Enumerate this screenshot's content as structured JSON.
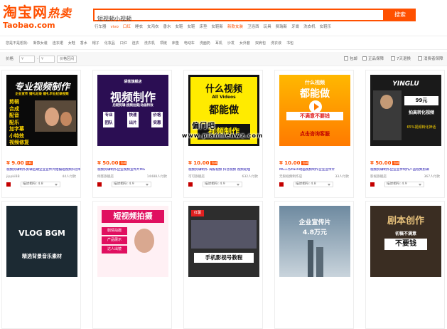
{
  "header": {
    "logo_cn": "淘宝网",
    "logo_sub": "热卖",
    "logo_en": "Taobao.com",
    "search_value": "短视频小视频",
    "search_button": "搜索",
    "hot_words": [
      {
        "label": "行车器",
        "hl": false
      },
      {
        "label": "vivo",
        "hl": true
      },
      {
        "label": "口红",
        "hl": true
      },
      {
        "label": "睡衣",
        "hl": false
      },
      {
        "label": "女鸿衣",
        "hl": false
      },
      {
        "label": "香水",
        "hl": false
      },
      {
        "label": "女鞋",
        "hl": false
      },
      {
        "label": "女鞋",
        "hl": false
      },
      {
        "label": "床垫",
        "hl": false
      },
      {
        "label": "女鞋新",
        "hl": false
      },
      {
        "label": "新款女装",
        "hl": true
      },
      {
        "label": "卫浴西",
        "hl": false
      },
      {
        "label": "玩具",
        "hl": false
      },
      {
        "label": "费瑞新",
        "hl": false
      },
      {
        "label": "牙膏",
        "hl": false
      },
      {
        "label": "洗衣机",
        "hl": false
      },
      {
        "label": "女鞋乐",
        "hl": false
      }
    ]
  },
  "nav": {
    "label": "您是不是想找:",
    "items": [
      "新款女装",
      "连衣裙",
      "女鞋",
      "香水",
      "帽子",
      "化妆品",
      "口红",
      "连衣",
      "洗衣机",
      "项链",
      "床垫",
      "电动车",
      "洗面奶",
      "耳机",
      "沙发",
      "女外套",
      "双肩包",
      "洗衣液",
      "书包"
    ]
  },
  "filter": {
    "price_label": "价格",
    "min_placeholder": "¥",
    "max_placeholder": "¥",
    "price_button": "价格区间",
    "checks": [
      "包邮",
      "正品保障",
      "7天退换",
      "消费者保障"
    ]
  },
  "products": [
    {
      "price": "¥ 9.00",
      "title": "视频剪辑制作剪辑后期企业宣传片拍摄短视频抖音制作配音剪辑",
      "shop": "jippkiBB",
      "sales": "44人付款",
      "rating": "描述相符: 4.8"
    },
    {
      "price": "¥ 50.00",
      "title": "视频剪辑制作企业视频宣传片MG",
      "shop": "倾客旗舰店",
      "sales": "14488人付款",
      "rating": "描述相符: 4.9"
    },
    {
      "price": "¥ 10.00",
      "title": "视频剪辑制作 海报视频 抖音视频 视频处理",
      "shop": "可可旗舰店",
      "sales": "632人付款",
      "rating": "描述相符: 4.9"
    },
    {
      "price": "¥ 10.00",
      "title": "MG工作flash动画视频制作企业宣传片",
      "shop": "无限视频制作店",
      "sales": "33人付款",
      "rating": "描述相符: 4.8"
    },
    {
      "price": "¥ 50.00",
      "title": "视频剪辑制作企业宣传制作产品视频剪辑",
      "shop": "影视旗舰店",
      "sales": "367人付款",
      "rating": "描述相符: 4.9"
    }
  ],
  "images": {
    "p1": {
      "l1": "专业视频制作",
      "l2": "企业宣传 婚礼纪录 婚礼毕业纪录视频",
      "list": [
        "剪辑",
        "合成",
        "配音",
        "配乐",
        "加字幕",
        "小特效",
        "视频修复"
      ]
    },
    "p2": {
      "shop": "袋客旗舰店",
      "main": "视频制作",
      "sub": "后期剪辑|视频拍摄|动画特效",
      "tags": [
        "专业团队",
        "快速出片",
        "价格实惠"
      ]
    },
    "p3": {
      "l1": "什么视频",
      "l2": "All Videos",
      "l3": "都能做",
      "l4": "视频制作"
    },
    "p4": {
      "l1": "什么视频",
      "l2": "都能做",
      "l3": "不满意不要钱",
      "l4": "点击咨询客服"
    },
    "p5": {
      "brand": "YINGLU",
      "price": "99元",
      "sub": "拍高转化视频",
      "rate": "65%视频转化神话"
    },
    "p6": {
      "text": "VLOG BGM",
      "sub": "精选背景音乐素材"
    },
    "p7": {
      "main": "短视频拍摄",
      "tags": [
        "剧情拍摄",
        "产品展示",
        "达人出镜"
      ]
    },
    "p8": {
      "top": "红薯",
      "main": "手机影视号教程"
    },
    "p9": {
      "l1": "企业宣传片",
      "l2": "4.8万元"
    },
    "p10": {
      "l1": "剧本创作",
      "l2": "初稿不满意",
      "l3": "不要钱"
    }
  },
  "watermark": {
    "cn": "偏门吧",
    "url": "www.pianmenwz.com"
  }
}
